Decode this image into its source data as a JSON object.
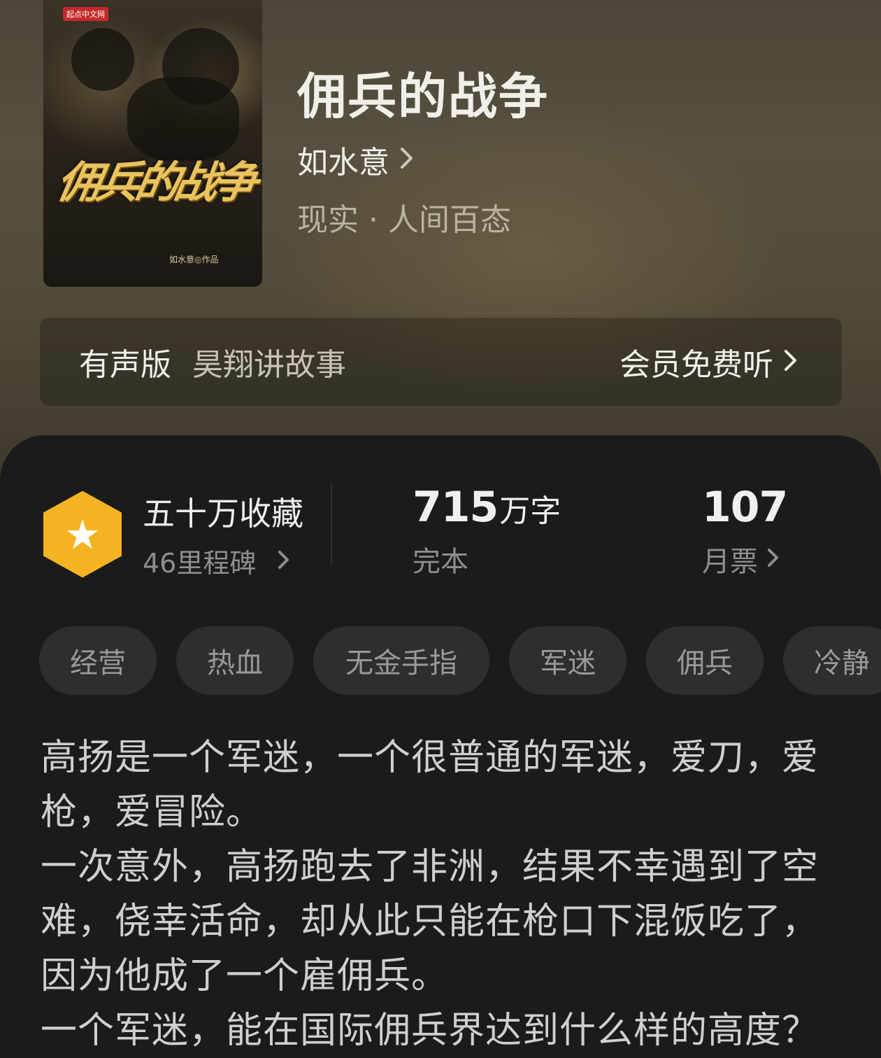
{
  "book": {
    "title": "佣兵的战争",
    "author": "如水意",
    "genre": "现实 · 人间百态",
    "cover": {
      "badge": "起点中文网",
      "title": "佣兵的战争",
      "author_credit": "如水意◎作品"
    }
  },
  "audio": {
    "label": "有声版",
    "narrator": "昊翔讲故事",
    "action": "会员免费听"
  },
  "stats": {
    "collection": "五十万收藏",
    "milestones": "46里程碑",
    "word_count": "715",
    "word_unit": "万字",
    "status": "完本",
    "monthly_tickets": "107",
    "monthly_tickets_label": "月票"
  },
  "tags": [
    "经营",
    "热血",
    "无金手指",
    "军迷",
    "佣兵",
    "冷静"
  ],
  "description": [
    "高扬是一个军迷，一个很普通的军迷，爱刀，爱枪，爱冒险。",
    "一次意外，高扬跑去了非洲，结果不幸遇到了空难，侥幸活命，却从此只能在枪口下混饭吃了，因为他成了一个雇佣兵。",
    "一个军迷，能在国际佣兵界达到什么样的高度？"
  ],
  "icons": {
    "chevron": "chevron-right-icon",
    "star": "star-icon"
  },
  "colors": {
    "accent_gold": "#f6b321",
    "panel_bg": "#1b1b1b",
    "tag_bg": "#2e2e2e"
  }
}
